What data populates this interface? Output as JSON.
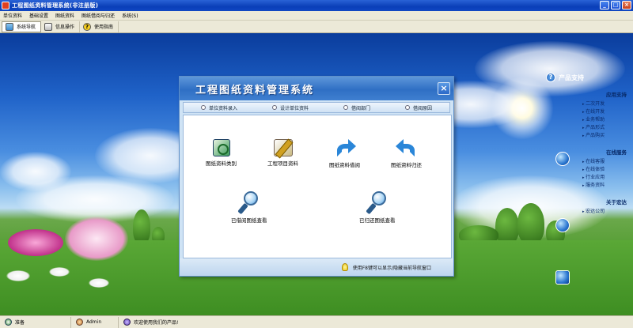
{
  "window": {
    "title": "工程图纸资料管理系统(非注册版)",
    "buttons": {
      "minimize": "_",
      "maximize": "□",
      "close": "×"
    }
  },
  "menu": [
    "单位资料",
    "基础设置",
    "图纸资料",
    "图纸借阅与归还",
    "系统(S)"
  ],
  "toolbar": [
    {
      "label": "系统导航",
      "icon": "nav-icon",
      "active": true
    },
    {
      "label": "信息操作",
      "icon": "info-icon",
      "active": false
    },
    {
      "label": "使用指南",
      "icon": "help-icon",
      "active": false
    }
  ],
  "dialog": {
    "title": "工程图纸资料管理系统",
    "tabs": [
      "单位资料录入",
      "设计单位资料",
      "借阅部门",
      "借阅原因"
    ],
    "functions": {
      "drawing_category": "图纸资料类别",
      "project_data": "工程项目资料",
      "borrow": "图纸资料借阅",
      "return": "图纸资料归还",
      "borrowed_view": "已借阅图纸查看",
      "returned_view": "已归还图纸查看"
    },
    "footer_hint": "使用F8键可以显示/隐藏当前导航窗口"
  },
  "side_panel": {
    "title": "产品支持",
    "groups": [
      {
        "title": "应用支持",
        "links": [
          "二次开发",
          "在线开发",
          "业务帮助",
          "产品形式",
          "产品购买"
        ]
      },
      {
        "title": "在线服务",
        "links": [
          "在线客服",
          "在线体验",
          "行业应用",
          "服务资料"
        ]
      },
      {
        "title": "关于宏达",
        "links": [
          "宏达公司"
        ]
      }
    ]
  },
  "status": {
    "ready": "准备",
    "user": "Admin",
    "welcome": "欢迎使用我们的产品!"
  }
}
